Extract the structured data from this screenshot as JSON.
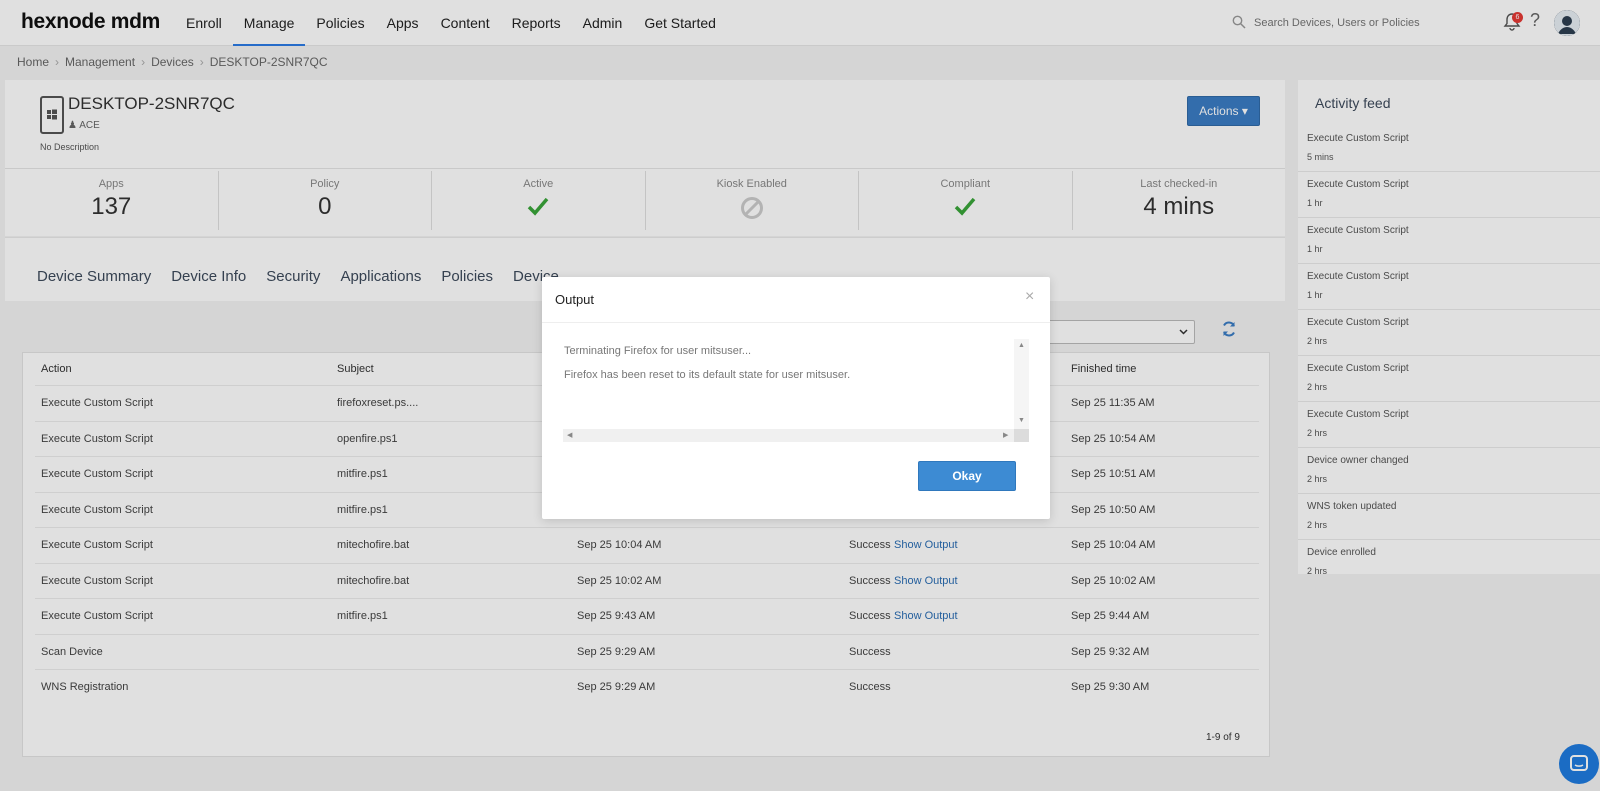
{
  "app": {
    "logo": "hexnode mdm"
  },
  "nav": {
    "items": [
      {
        "label": "Enroll",
        "active": false
      },
      {
        "label": "Manage",
        "active": true
      },
      {
        "label": "Policies",
        "active": false
      },
      {
        "label": "Apps",
        "active": false
      },
      {
        "label": "Content",
        "active": false
      },
      {
        "label": "Reports",
        "active": false
      },
      {
        "label": "Admin",
        "active": false
      },
      {
        "label": "Get Started",
        "active": false
      }
    ],
    "search_placeholder": "Search Devices, Users or Policies",
    "notification_count": "6",
    "help_label": "?"
  },
  "breadcrumb": [
    "Home",
    "Management",
    "Devices",
    "DESKTOP-2SNR7QC"
  ],
  "device": {
    "name": "DESKTOP-2SNR7QC",
    "user": "ACE",
    "description": "No Description",
    "actions_label": "Actions ▾"
  },
  "stats": [
    {
      "label": "Apps",
      "value": "137",
      "kind": "number"
    },
    {
      "label": "Policy",
      "value": "0",
      "kind": "number"
    },
    {
      "label": "Active",
      "kind": "check"
    },
    {
      "label": "Kiosk Enabled",
      "kind": "disabled"
    },
    {
      "label": "Compliant",
      "kind": "check"
    },
    {
      "label": "Last checked-in",
      "value": "4 mins",
      "kind": "number"
    }
  ],
  "tabs": [
    "Device Summary",
    "Device Info",
    "Security",
    "Applications",
    "Policies",
    "Device"
  ],
  "table": {
    "headers": {
      "action": "Action",
      "subject": "Subject",
      "finished": "Finished time"
    },
    "rows": [
      {
        "action": "Execute Custom Script",
        "subject": "firefoxreset.ps....",
        "created": "",
        "status": "",
        "output": "",
        "finished": "Sep 25 11:35 AM"
      },
      {
        "action": "Execute Custom Script",
        "subject": "openfire.ps1",
        "created": "",
        "status": "",
        "output": "",
        "finished": "Sep 25 10:54 AM"
      },
      {
        "action": "Execute Custom Script",
        "subject": "mitfire.ps1",
        "created": "",
        "status": "",
        "output": "",
        "finished": "Sep 25 10:51 AM"
      },
      {
        "action": "Execute Custom Script",
        "subject": "mitfire.ps1",
        "created": "",
        "status": "",
        "output": "",
        "finished": "Sep 25 10:50 AM"
      },
      {
        "action": "Execute Custom Script",
        "subject": "mitechofire.bat",
        "created": "Sep 25 10:04 AM",
        "status": "Success",
        "output": "Show Output",
        "finished": "Sep 25 10:04 AM"
      },
      {
        "action": "Execute Custom Script",
        "subject": "mitechofire.bat",
        "created": "Sep 25 10:02 AM",
        "status": "Success",
        "output": "Show Output",
        "finished": "Sep 25 10:02 AM"
      },
      {
        "action": "Execute Custom Script",
        "subject": "mitfire.ps1",
        "created": "Sep 25 9:43 AM",
        "status": "Success",
        "output": "Show Output",
        "finished": "Sep 25 9:44 AM"
      },
      {
        "action": "Scan Device",
        "subject": "",
        "created": "Sep 25 9:29 AM",
        "status": "Success",
        "output": "",
        "finished": "Sep 25 9:32 AM"
      },
      {
        "action": "WNS Registration",
        "subject": "",
        "created": "Sep 25 9:29 AM",
        "status": "Success",
        "output": "",
        "finished": "Sep 25 9:30 AM"
      }
    ],
    "pagination": "1-9 of 9"
  },
  "feed": {
    "title": "Activity feed",
    "items": [
      {
        "action": "Execute Custom Script",
        "time": "5 mins"
      },
      {
        "action": "Execute Custom Script",
        "time": "1 hr"
      },
      {
        "action": "Execute Custom Script",
        "time": "1 hr"
      },
      {
        "action": "Execute Custom Script",
        "time": "1 hr"
      },
      {
        "action": "Execute Custom Script",
        "time": "2 hrs"
      },
      {
        "action": "Execute Custom Script",
        "time": "2 hrs"
      },
      {
        "action": "Execute Custom Script",
        "time": "2 hrs"
      },
      {
        "action": "Device owner changed",
        "time": "2 hrs"
      },
      {
        "action": "WNS token updated",
        "time": "2 hrs"
      },
      {
        "action": "Device enrolled",
        "time": "2 hrs"
      }
    ]
  },
  "modal": {
    "title": "Output",
    "close": "×",
    "lines": [
      "Terminating Firefox for user mitsuser...",
      "Firefox has been reset to its default state for user mitsuser."
    ],
    "okay_label": "Okay"
  },
  "colors": {
    "accent": "#3b7dc4",
    "link": "#2a6db3",
    "success_check": "#3aa63a"
  }
}
